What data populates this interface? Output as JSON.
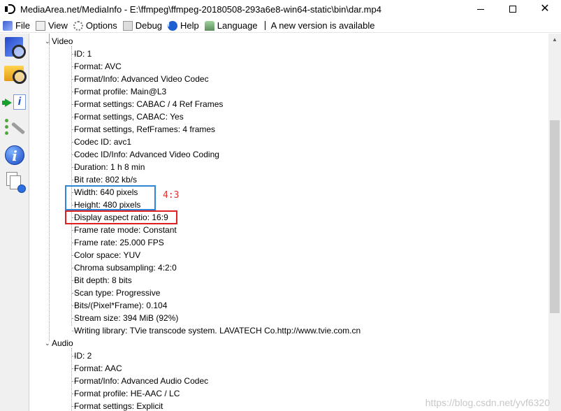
{
  "window": {
    "title": "MediaArea.net/MediaInfo - E:\\ffmpeg\\ffmpeg-20180508-293a6e8-win64-static\\bin\\dar.mp4",
    "close_glyph": "✕"
  },
  "menu": {
    "items": [
      {
        "label": "File",
        "icon": "file-icon"
      },
      {
        "label": "View",
        "icon": "view-icon"
      },
      {
        "label": "Options",
        "icon": "options-icon"
      },
      {
        "label": "Debug",
        "icon": "debug-icon"
      },
      {
        "label": "Help",
        "icon": "help-icon"
      },
      {
        "label": "Language",
        "icon": "language-icon"
      }
    ],
    "help_glyph": "i",
    "notice": "A new version is available"
  },
  "toolbar": {
    "about_glyph": "i",
    "export_glyph": "i"
  },
  "tree": {
    "video": {
      "label": "Video",
      "fields": [
        "ID: 1",
        "Format: AVC",
        "Format/Info: Advanced Video Codec",
        "Format profile: Main@L3",
        "Format settings: CABAC / 4 Ref Frames",
        "Format settings, CABAC: Yes",
        "Format settings, RefFrames: 4 frames",
        "Codec ID: avc1",
        "Codec ID/Info: Advanced Video Coding",
        "Duration: 1 h 8 min",
        "Bit rate: 802 kb/s",
        "Width: 640 pixels",
        "Height: 480 pixels",
        "Display aspect ratio: 16:9",
        "Frame rate mode: Constant",
        "Frame rate: 25.000 FPS",
        "Color space: YUV",
        "Chroma subsampling: 4:2:0",
        "Bit depth: 8 bits",
        "Scan type: Progressive",
        "Bits/(Pixel*Frame): 0.104",
        "Stream size: 394 MiB (92%)",
        "Writing library: TVie transcode system. LAVATECH Co.http://www.tvie.com.cn"
      ]
    },
    "audio": {
      "label": "Audio",
      "fields": [
        "ID: 2",
        "Format: AAC",
        "Format/Info: Advanced Audio Codec",
        "Format profile: HE-AAC / LC",
        "Format settings: Explicit"
      ]
    },
    "expander_glyph": "⌄"
  },
  "annotation": {
    "label": "4:3",
    "box_blue_color": "#2f86d8",
    "box_red_color": "#e02020"
  },
  "scrollbar": {
    "up_glyph": "▲"
  },
  "watermark": "https://blog.csdn.net/yvf6320"
}
